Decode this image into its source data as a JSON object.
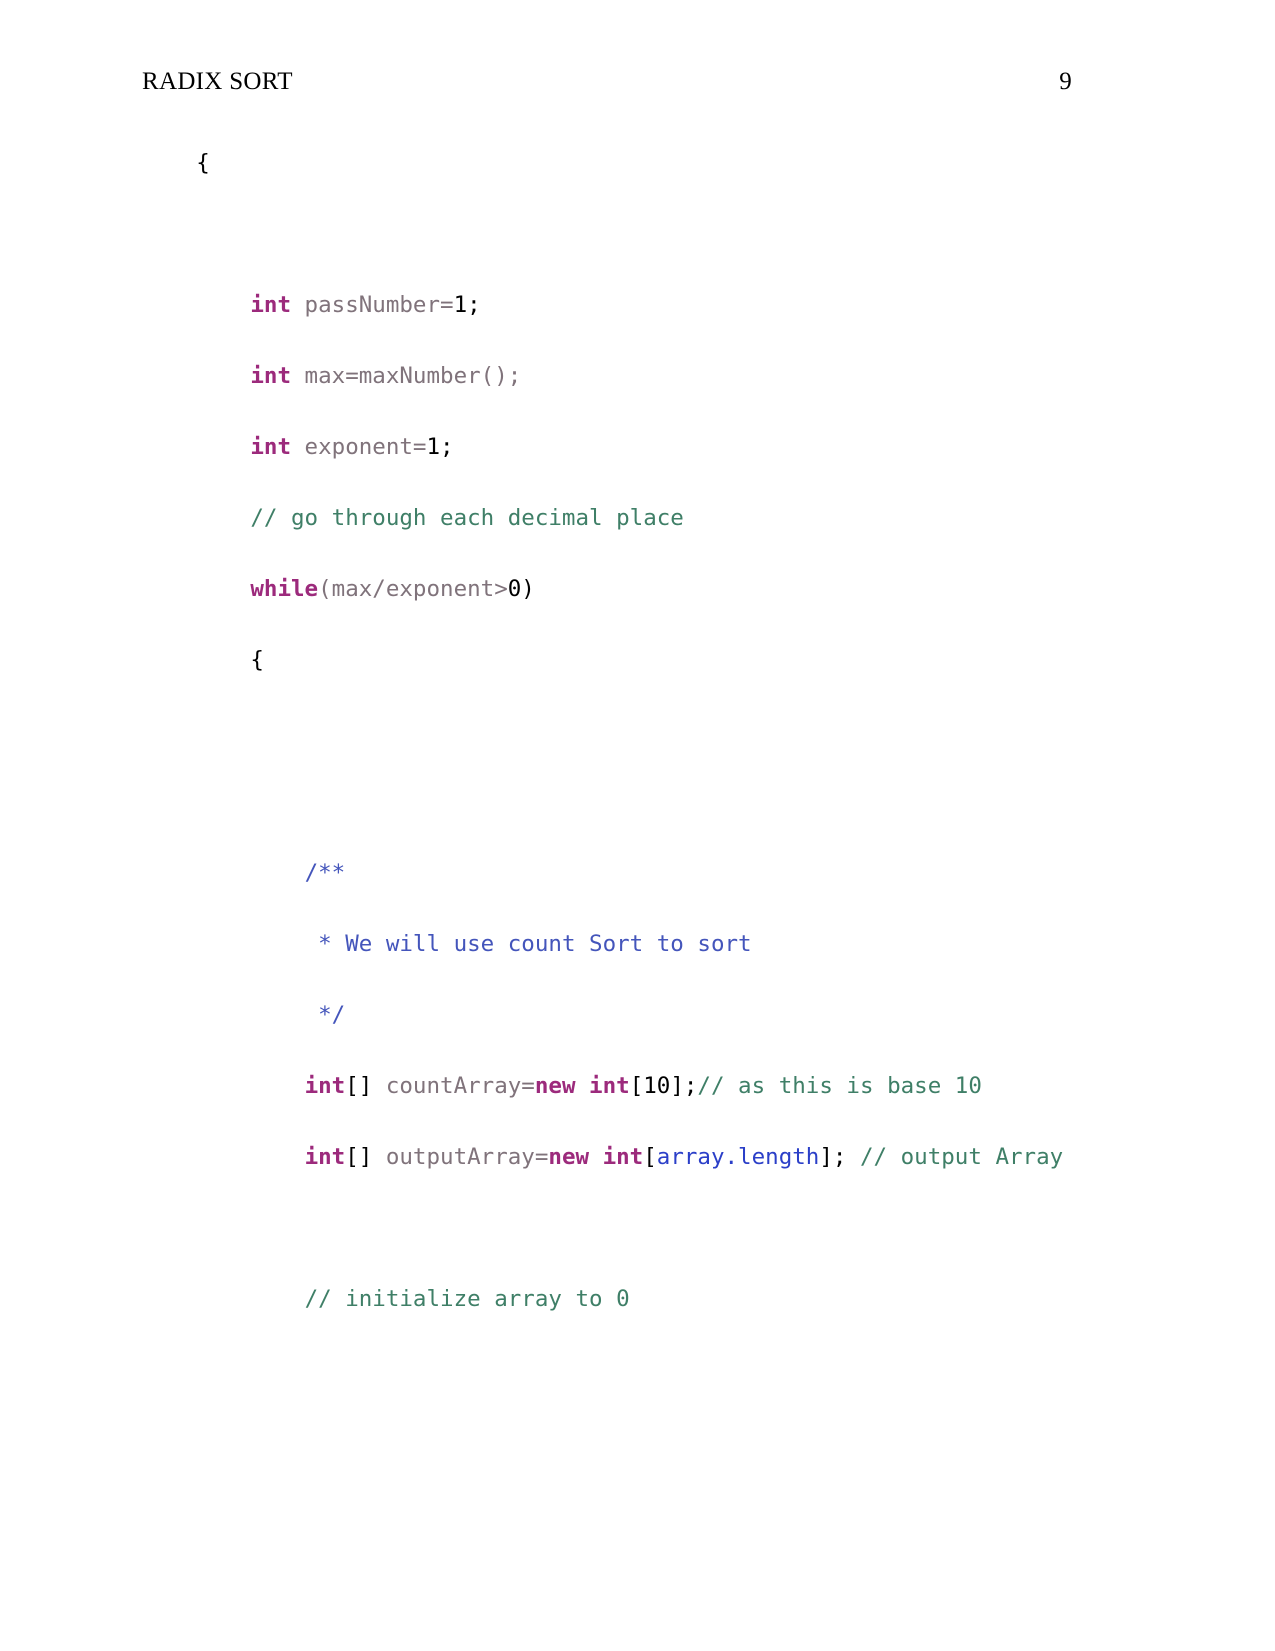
{
  "document": {
    "running_head_title": "RADIX SORT",
    "page_number": "9"
  },
  "colors": {
    "keyword": "#9c2a7c",
    "identifier": "#80737b",
    "plain": "#000000",
    "line_comment": "#3f7f67",
    "doc_comment": "#4455bb",
    "field_access": "#2b3fc8",
    "page_background": "#ffffff",
    "text": "#000000"
  },
  "code": {
    "language": "java",
    "lines": [
      {
        "id": "line-open-brace-outer",
        "indent": "    ",
        "tokens": [
          {
            "text": "{",
            "kind": "plain"
          }
        ]
      },
      {
        "id": "line-blank-1",
        "indent": "",
        "tokens": []
      },
      {
        "id": "line-pass-number",
        "indent": "        ",
        "tokens": [
          {
            "text": "int",
            "kind": "keyword"
          },
          {
            "text": " passNumber=",
            "kind": "identifier"
          },
          {
            "text": "1;",
            "kind": "plain"
          }
        ]
      },
      {
        "id": "line-max",
        "indent": "        ",
        "tokens": [
          {
            "text": "int",
            "kind": "keyword"
          },
          {
            "text": " max=maxNumber();",
            "kind": "identifier"
          }
        ]
      },
      {
        "id": "line-exponent",
        "indent": "        ",
        "tokens": [
          {
            "text": "int",
            "kind": "keyword"
          },
          {
            "text": " exponent=",
            "kind": "identifier"
          },
          {
            "text": "1;",
            "kind": "plain"
          }
        ]
      },
      {
        "id": "line-comment-decimal-place",
        "indent": "        ",
        "tokens": [
          {
            "text": "// go through each decimal place",
            "kind": "line_comment"
          }
        ]
      },
      {
        "id": "line-while",
        "indent": "        ",
        "tokens": [
          {
            "text": "while",
            "kind": "keyword"
          },
          {
            "text": "(max/exponent>",
            "kind": "identifier"
          },
          {
            "text": "0)",
            "kind": "plain"
          }
        ]
      },
      {
        "id": "line-open-brace-inner",
        "indent": "        ",
        "tokens": [
          {
            "text": "{",
            "kind": "plain"
          }
        ]
      },
      {
        "id": "line-blank-2",
        "indent": "",
        "tokens": []
      },
      {
        "id": "line-blank-3",
        "indent": "",
        "tokens": []
      },
      {
        "id": "line-doc-open",
        "indent": "            ",
        "tokens": [
          {
            "text": "/**",
            "kind": "doc_comment"
          }
        ]
      },
      {
        "id": "line-doc-body",
        "indent": "            ",
        "tokens": [
          {
            "text": " * We will use count Sort to sort",
            "kind": "doc_comment"
          }
        ]
      },
      {
        "id": "line-doc-close",
        "indent": "            ",
        "tokens": [
          {
            "text": " */",
            "kind": "doc_comment"
          }
        ]
      },
      {
        "id": "line-count-array",
        "indent": "            ",
        "tokens": [
          {
            "text": "int",
            "kind": "keyword"
          },
          {
            "text": "[]",
            "kind": "plain"
          },
          {
            "text": " countArray=",
            "kind": "identifier"
          },
          {
            "text": "new",
            "kind": "keyword"
          },
          {
            "text": " ",
            "kind": "plain"
          },
          {
            "text": "int",
            "kind": "keyword"
          },
          {
            "text": "[10];",
            "kind": "plain"
          },
          {
            "text": "// as this is base 10",
            "kind": "line_comment"
          }
        ]
      },
      {
        "id": "line-output-array",
        "indent": "            ",
        "tokens": [
          {
            "text": "int",
            "kind": "keyword"
          },
          {
            "text": "[]",
            "kind": "plain"
          },
          {
            "text": " outputArray=",
            "kind": "identifier"
          },
          {
            "text": "new",
            "kind": "keyword"
          },
          {
            "text": " ",
            "kind": "plain"
          },
          {
            "text": "int",
            "kind": "keyword"
          },
          {
            "text": "[",
            "kind": "plain"
          },
          {
            "text": "array.length",
            "kind": "field_access"
          },
          {
            "text": "]; ",
            "kind": "plain"
          },
          {
            "text": "// output Array",
            "kind": "line_comment"
          }
        ]
      },
      {
        "id": "line-blank-4",
        "indent": "",
        "tokens": []
      },
      {
        "id": "line-comment-initialize",
        "indent": "            ",
        "tokens": [
          {
            "text": "// initialize array to 0",
            "kind": "line_comment"
          }
        ]
      }
    ]
  }
}
